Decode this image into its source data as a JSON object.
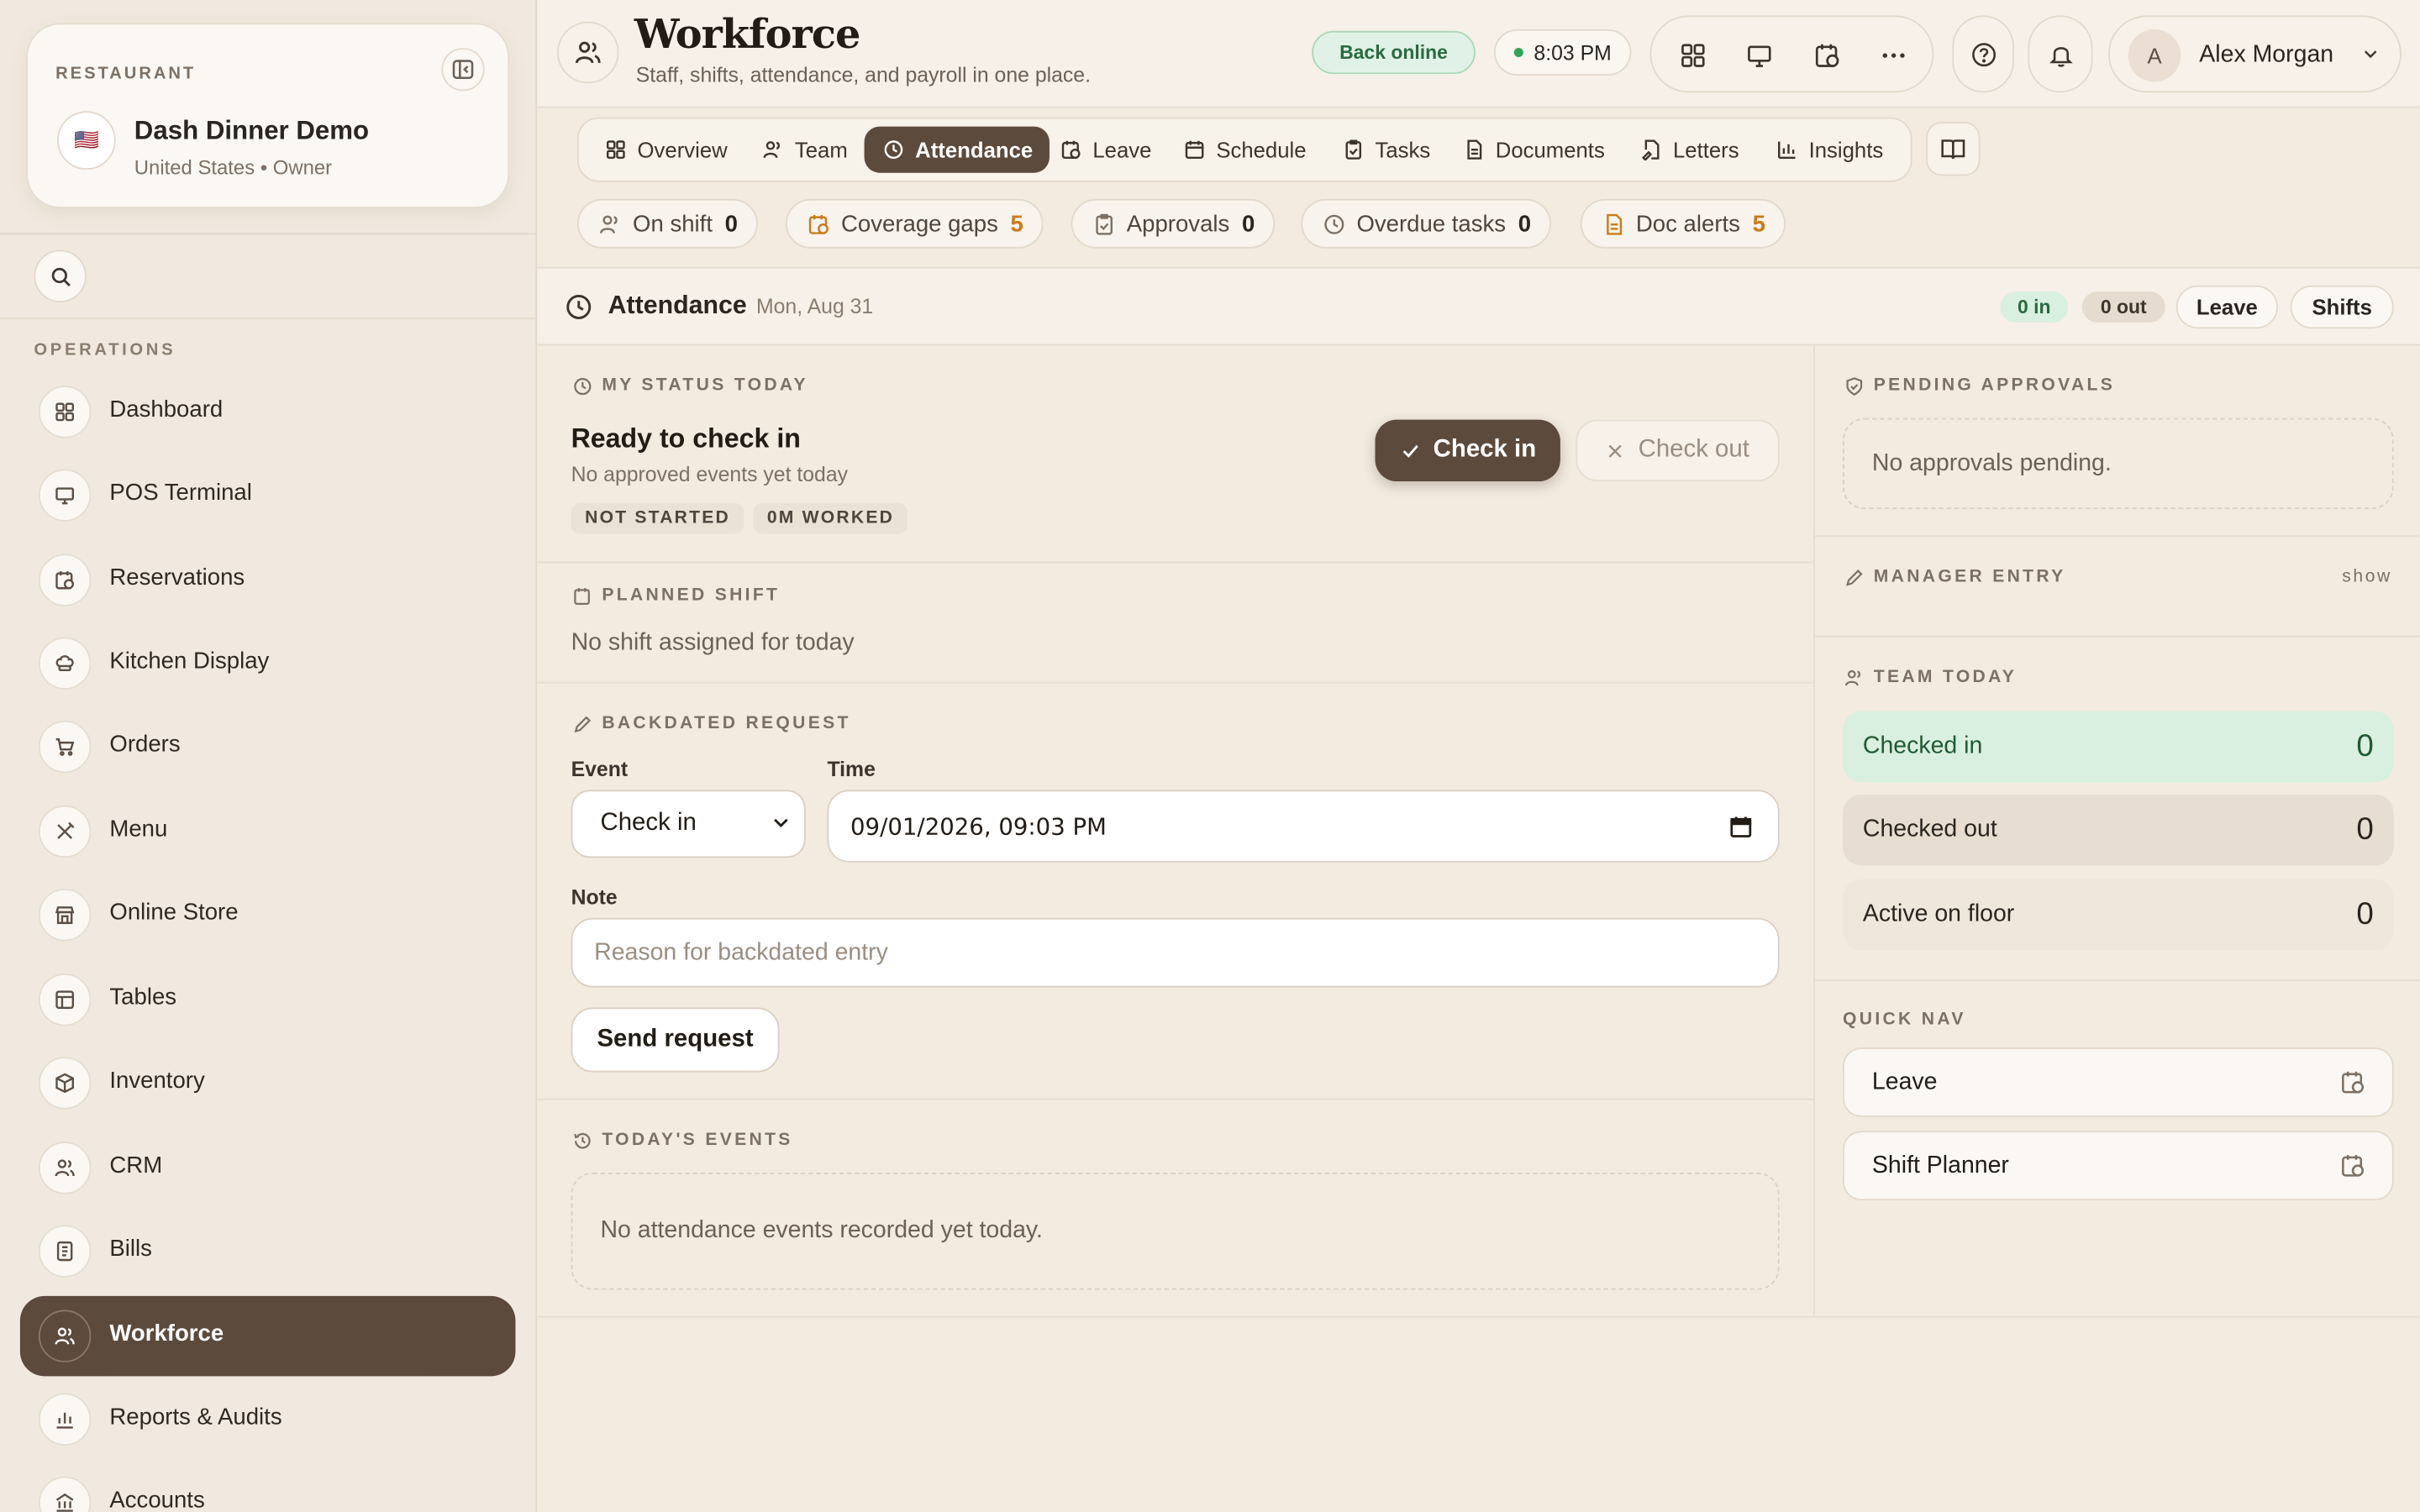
{
  "restaurant": {
    "label": "RESTAURANT",
    "name": "Dash Dinner Demo",
    "flag": "🇺🇸",
    "subtitle": "United States • Owner"
  },
  "sidebar": {
    "section_label": "OPERATIONS",
    "items": [
      {
        "label": "Dashboard",
        "icon": "grid-icon"
      },
      {
        "label": "POS Terminal",
        "icon": "monitor-icon"
      },
      {
        "label": "Reservations",
        "icon": "calendar-clock-icon"
      },
      {
        "label": "Kitchen Display",
        "icon": "chef-hat-icon"
      },
      {
        "label": "Orders",
        "icon": "cart-icon"
      },
      {
        "label": "Menu",
        "icon": "utensils-icon"
      },
      {
        "label": "Online Store",
        "icon": "store-icon"
      },
      {
        "label": "Tables",
        "icon": "table-icon"
      },
      {
        "label": "Inventory",
        "icon": "box-icon"
      },
      {
        "label": "CRM",
        "icon": "users-icon"
      },
      {
        "label": "Bills",
        "icon": "receipt-icon"
      },
      {
        "label": "Workforce",
        "icon": "users-icon",
        "active": true
      },
      {
        "label": "Reports & Audits",
        "icon": "bar-chart-icon"
      },
      {
        "label": "Accounts",
        "icon": "bank-icon"
      }
    ]
  },
  "header": {
    "title": "Workforce",
    "subtitle": "Staff, shifts, attendance, and payroll in one place.",
    "online_status": "Back online",
    "time": "8:03 PM",
    "user": {
      "initial": "A",
      "name": "Alex Morgan"
    }
  },
  "tabs": [
    {
      "label": "Overview",
      "icon": "grid-icon"
    },
    {
      "label": "Team",
      "icon": "users-icon"
    },
    {
      "label": "Attendance",
      "icon": "clock-icon",
      "active": true
    },
    {
      "label": "Leave",
      "icon": "calendar-clock-icon"
    },
    {
      "label": "Schedule",
      "icon": "calendar-icon"
    },
    {
      "label": "Tasks",
      "icon": "clipboard-check-icon"
    },
    {
      "label": "Documents",
      "icon": "file-icon"
    },
    {
      "label": "Letters",
      "icon": "file-signature-icon"
    },
    {
      "label": "Insights",
      "icon": "bar-chart-icon"
    }
  ],
  "stats": [
    {
      "label": "On shift",
      "value": "0",
      "warn": false
    },
    {
      "label": "Coverage gaps",
      "value": "5",
      "warn": true
    },
    {
      "label": "Approvals",
      "value": "0",
      "warn": false
    },
    {
      "label": "Overdue tasks",
      "value": "0",
      "warn": false
    },
    {
      "label": "Doc alerts",
      "value": "5",
      "warn": true
    }
  ],
  "attendance": {
    "title": "Attendance",
    "date": "Mon, Aug 31",
    "in_badge": "0 in",
    "out_badge": "0 out",
    "leave_btn": "Leave",
    "shifts_btn": "Shifts"
  },
  "my_status": {
    "label": "MY STATUS TODAY",
    "heading": "Ready to check in",
    "sub": "No approved events yet today",
    "tags": [
      "NOT STARTED",
      "0M WORKED"
    ],
    "check_in": "Check in",
    "check_out": "Check out"
  },
  "planned_shift": {
    "label": "PLANNED SHIFT",
    "text": "No shift assigned for today"
  },
  "backdated": {
    "label": "BACKDATED REQUEST",
    "event_label": "Event",
    "event_value": "Check in",
    "time_label": "Time",
    "time_value": "09/01/2026, 09:03 PM",
    "note_label": "Note",
    "note_placeholder": "Reason for backdated entry",
    "send": "Send request"
  },
  "events": {
    "label": "TODAY'S EVENTS",
    "empty": "No attendance events recorded yet today."
  },
  "pending": {
    "label": "PENDING APPROVALS",
    "empty": "No approvals pending."
  },
  "manager": {
    "label": "MANAGER ENTRY",
    "toggle": "show"
  },
  "team_today": {
    "label": "TEAM TODAY",
    "rows": [
      {
        "label": "Checked in",
        "value": "0"
      },
      {
        "label": "Checked out",
        "value": "0"
      },
      {
        "label": "Active on floor",
        "value": "0"
      }
    ]
  },
  "quick_nav": {
    "label": "QUICK NAV",
    "items": [
      "Leave",
      "Shift Planner"
    ]
  },
  "colors": {
    "accent": "#5c4a3c",
    "background": "#f3ebe0",
    "success": "#2a6a40",
    "warning": "#c97b1a"
  }
}
